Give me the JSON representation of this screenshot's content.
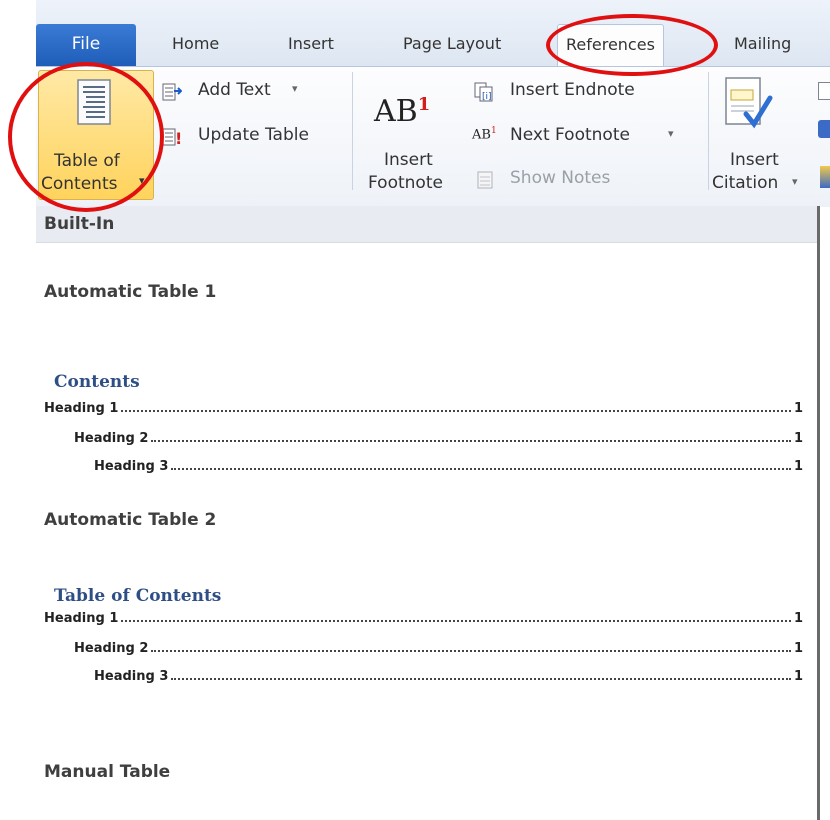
{
  "tabs": {
    "file": "File",
    "home": "Home",
    "insert": "Insert",
    "page_layout": "Page Layout",
    "references": "References",
    "mailings": "Mailing"
  },
  "ribbon": {
    "toc_line1": "Table of",
    "toc_line2": "Contents",
    "add_text": "Add Text",
    "update_table": "Update Table",
    "insert_footnote_line1": "Insert",
    "insert_footnote_line2": "Footnote",
    "insert_endnote": "Insert Endnote",
    "next_footnote": "Next Footnote",
    "show_notes": "Show Notes",
    "insert_citation_line1": "Insert",
    "insert_citation_line2": "Citation",
    "ab_glyph": "AB",
    "ab_superscript": "1"
  },
  "gallery": {
    "section_header": "Built-In",
    "items": [
      {
        "title": "Automatic Table 1",
        "heading": "Contents",
        "lines": [
          {
            "label": "Heading 1",
            "page": "1"
          },
          {
            "label": "Heading 2",
            "page": "1"
          },
          {
            "label": "Heading 3",
            "page": "1"
          }
        ]
      },
      {
        "title": "Automatic Table 2",
        "heading": "Table of Contents",
        "lines": [
          {
            "label": "Heading 1",
            "page": "1"
          },
          {
            "label": "Heading 2",
            "page": "1"
          },
          {
            "label": "Heading 3",
            "page": "1"
          }
        ]
      },
      {
        "title": "Manual Table"
      }
    ]
  },
  "colors": {
    "annotation": "#e01010",
    "file_tab": "#1f5db8",
    "toc_highlight": "#ffd35c",
    "toc_heading": "#2e4f86"
  }
}
